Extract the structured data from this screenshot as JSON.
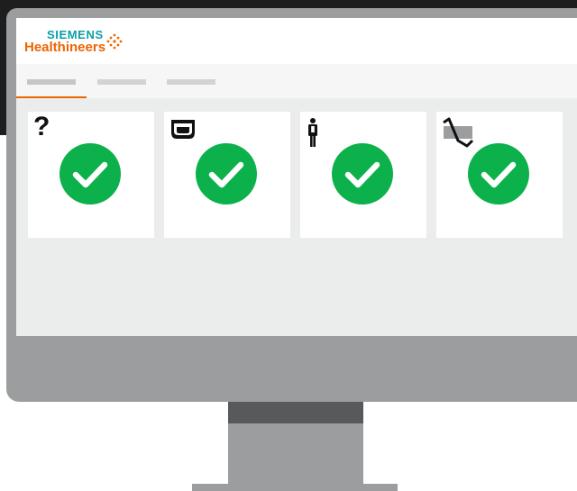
{
  "brand": {
    "line1": "SIEMENS",
    "line2": "Healthineers"
  },
  "nav": {
    "tabs": [
      {
        "label": "",
        "active": true
      },
      {
        "label": "",
        "active": false
      },
      {
        "label": "",
        "active": false
      }
    ]
  },
  "cards": [
    {
      "icon": "question-mark-icon",
      "glyph": "?",
      "status": "check-icon"
    },
    {
      "icon": "scanner-bed-icon",
      "glyph": "",
      "status": "check-icon"
    },
    {
      "icon": "patient-figure-icon",
      "glyph": "",
      "status": "check-icon"
    },
    {
      "icon": "signal-waveform-icon",
      "glyph": "",
      "status": "check-icon"
    }
  ],
  "colors": {
    "brand_teal": "#0a9fa6",
    "brand_orange": "#ec6602",
    "status_green": "#0cb14b",
    "screen_bg": "#ebecec",
    "monitor_frame": "#9b9d9f"
  }
}
